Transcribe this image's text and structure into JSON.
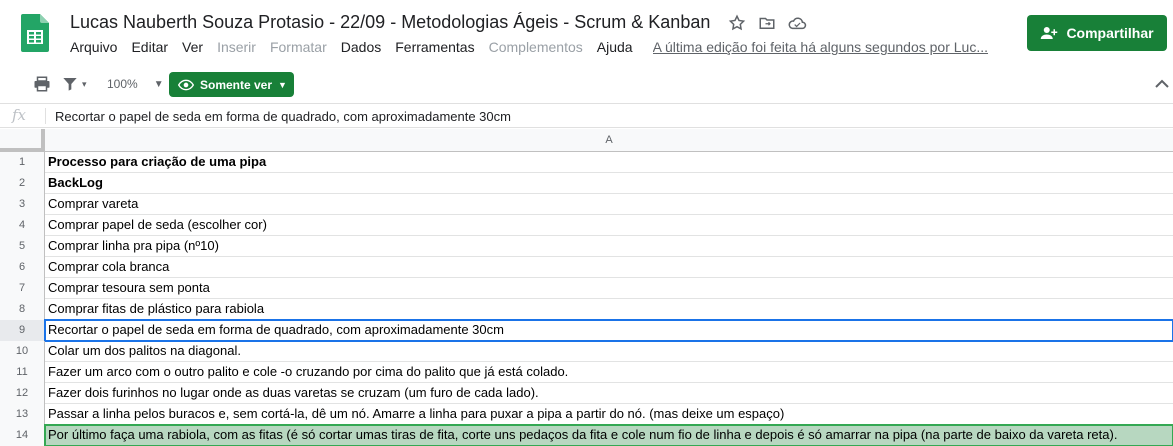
{
  "header": {
    "title": "Lucas Nauberth Souza Protasio - 22/09 - Metodologias Ágeis - Scrum & Kanban",
    "menu": [
      {
        "label": "Arquivo",
        "disabled": false
      },
      {
        "label": "Editar",
        "disabled": false
      },
      {
        "label": "Ver",
        "disabled": false
      },
      {
        "label": "Inserir",
        "disabled": true
      },
      {
        "label": "Formatar",
        "disabled": true
      },
      {
        "label": "Dados",
        "disabled": false
      },
      {
        "label": "Ferramentas",
        "disabled": false
      },
      {
        "label": "Complementos",
        "disabled": true
      },
      {
        "label": "Ajuda",
        "disabled": false
      }
    ],
    "last_edit": "A última edição foi feita há alguns segundos por Luc...",
    "share_label": "Compartilhar",
    "icons": [
      "star-icon",
      "move-to-folder-icon",
      "cloud-status-icon"
    ]
  },
  "toolbar": {
    "zoom": "100%",
    "mode_label": "Somente ver"
  },
  "formula_bar": {
    "fx": "fx",
    "content": "Recortar o papel de seda em forma de quadrado, com aproximadamente 30cm"
  },
  "grid": {
    "column_header": "A",
    "rows": [
      {
        "n": "1",
        "text": "Processo para criação de uma pipa",
        "bold": true
      },
      {
        "n": "2",
        "text": "BackLog",
        "bold": true
      },
      {
        "n": "3",
        "text": "Comprar vareta",
        "bold": false
      },
      {
        "n": "4",
        "text": "Comprar papel de seda (escolher cor)",
        "bold": false
      },
      {
        "n": "5",
        "text": "Comprar linha pra pipa (nº10)",
        "bold": false
      },
      {
        "n": "6",
        "text": "Comprar cola branca",
        "bold": false
      },
      {
        "n": "7",
        "text": "Comprar tesoura sem ponta",
        "bold": false
      },
      {
        "n": "8",
        "text": "Comprar fitas de plástico para rabiola",
        "bold": false
      },
      {
        "n": "9",
        "text": "Recortar o papel de seda em forma de quadrado, com aproximadamente 30cm",
        "bold": false,
        "state": "selected"
      },
      {
        "n": "10",
        "text": "Colar um dos palitos na diagonal.",
        "bold": false
      },
      {
        "n": "11",
        "text": "Fazer um arco com o outro palito e cole -o cruzando por cima do palito que já está colado.",
        "bold": false
      },
      {
        "n": "12",
        "text": "Fazer dois furinhos no lugar onde as duas varetas se cruzam (um furo de cada lado).",
        "bold": false
      },
      {
        "n": "13",
        "text": "Passar a linha pelos buracos e, sem cortá-la, dê um nó. Amarre a linha para puxar a pipa a partir do nó. (mas deixe um espaço)",
        "bold": false
      },
      {
        "n": "14",
        "text": "Por último faça uma rabiola, com as fitas (é só cortar umas tiras de fita, corte uns pedaços da fita e cole num fio de linha e depois é só amarrar na pipa (na parte de baixo da vareta reta).",
        "bold": false,
        "state": "highlight"
      }
    ]
  },
  "colors": {
    "brand_green": "#188038",
    "selection_blue": "#1a73e8",
    "highlight_green": "#b7d7c0"
  }
}
